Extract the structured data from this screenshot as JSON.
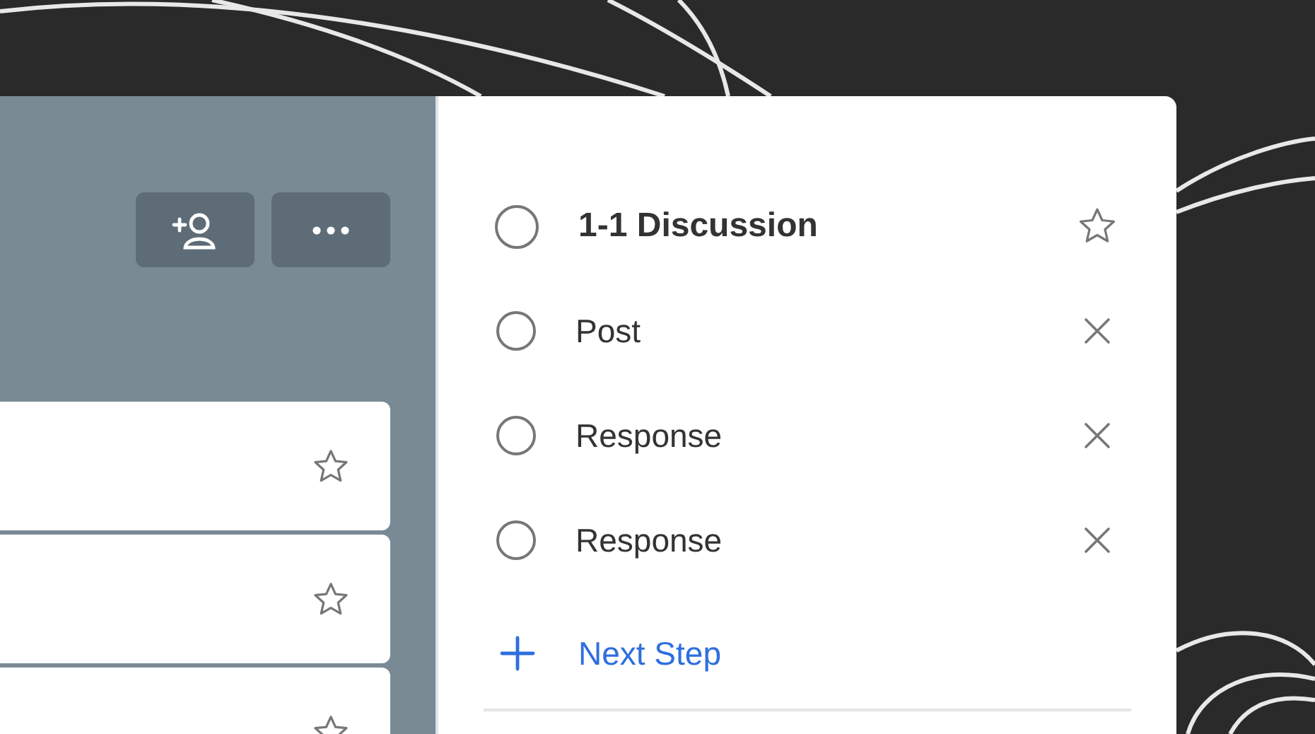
{
  "list_cards": [
    {
      "starred": false
    },
    {
      "starred": false
    },
    {
      "starred": false
    }
  ],
  "task": {
    "title": "1-1 Discussion",
    "completed": false,
    "starred": false
  },
  "steps": [
    {
      "title": "Post",
      "completed": false
    },
    {
      "title": "Response",
      "completed": false
    },
    {
      "title": "Response",
      "completed": false
    }
  ],
  "add_step": {
    "label": "Next Step"
  }
}
